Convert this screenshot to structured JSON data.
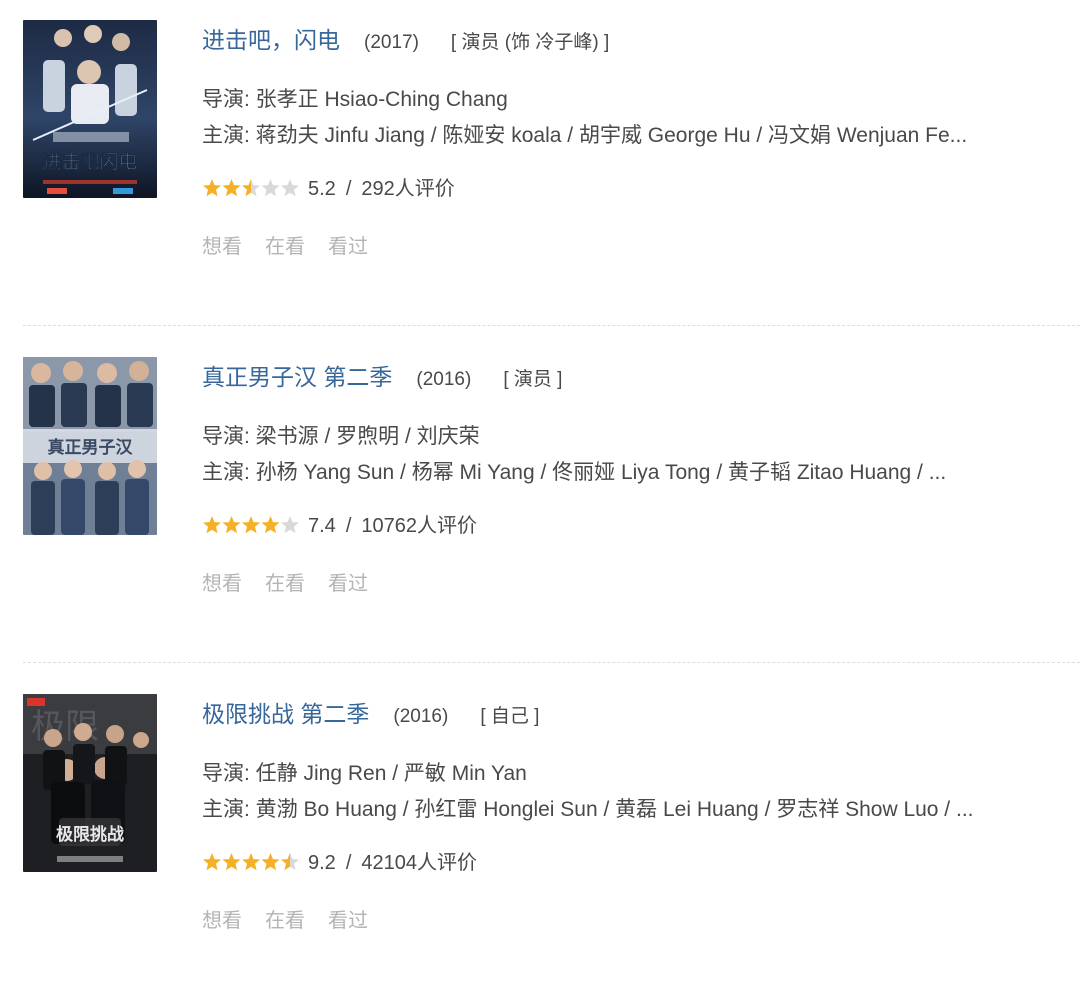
{
  "items": [
    {
      "title": "进击吧，闪电",
      "year": "(2017)",
      "role": "[ 演员 (饰 冷子峰) ]",
      "director": "导演: 张孝正 Hsiao-Ching Chang",
      "cast": "主演: 蒋劲夫 Jinfu Jiang / 陈娅安 koala / 胡宇威 George Hu / 冯文娟 Wenjuan Fe...",
      "stars": 2.5,
      "score": "5.2",
      "separator": "/",
      "votes": "292人评价",
      "actions": [
        "想看",
        "在看",
        "看过"
      ],
      "poster_text": "进击吧闪电"
    },
    {
      "title": "真正男子汉 第二季",
      "year": "(2016)",
      "role": "[ 演员 ]",
      "director": "导演: 梁书源 / 罗煦明 / 刘庆荣",
      "cast": "主演: 孙杨 Yang Sun / 杨幂 Mi Yang / 佟丽娅 Liya Tong / 黄子韬 Zitao Huang / ...",
      "stars": 4,
      "score": "7.4",
      "separator": "/",
      "votes": "10762人评价",
      "actions": [
        "想看",
        "在看",
        "看过"
      ],
      "poster_text": "真正男子汉"
    },
    {
      "title": "极限挑战 第二季",
      "year": "(2016)",
      "role": "[ 自己 ]",
      "director": "导演: 任静 Jing Ren / 严敏 Min Yan",
      "cast": "主演: 黄渤 Bo Huang / 孙红雷 Honglei Sun / 黄磊 Lei Huang / 罗志祥 Show Luo / ...",
      "stars": 4.5,
      "score": "9.2",
      "separator": "/",
      "votes": "42104人评价",
      "actions": [
        "想看",
        "在看",
        "看过"
      ],
      "poster_text": "极限挑战"
    }
  ],
  "colors": {
    "title": "#37679b",
    "text": "#494949",
    "muted": "#b4b4b4",
    "star_on": "#f4b128",
    "star_off": "#d9d9d9",
    "divider": "#dddddd"
  }
}
